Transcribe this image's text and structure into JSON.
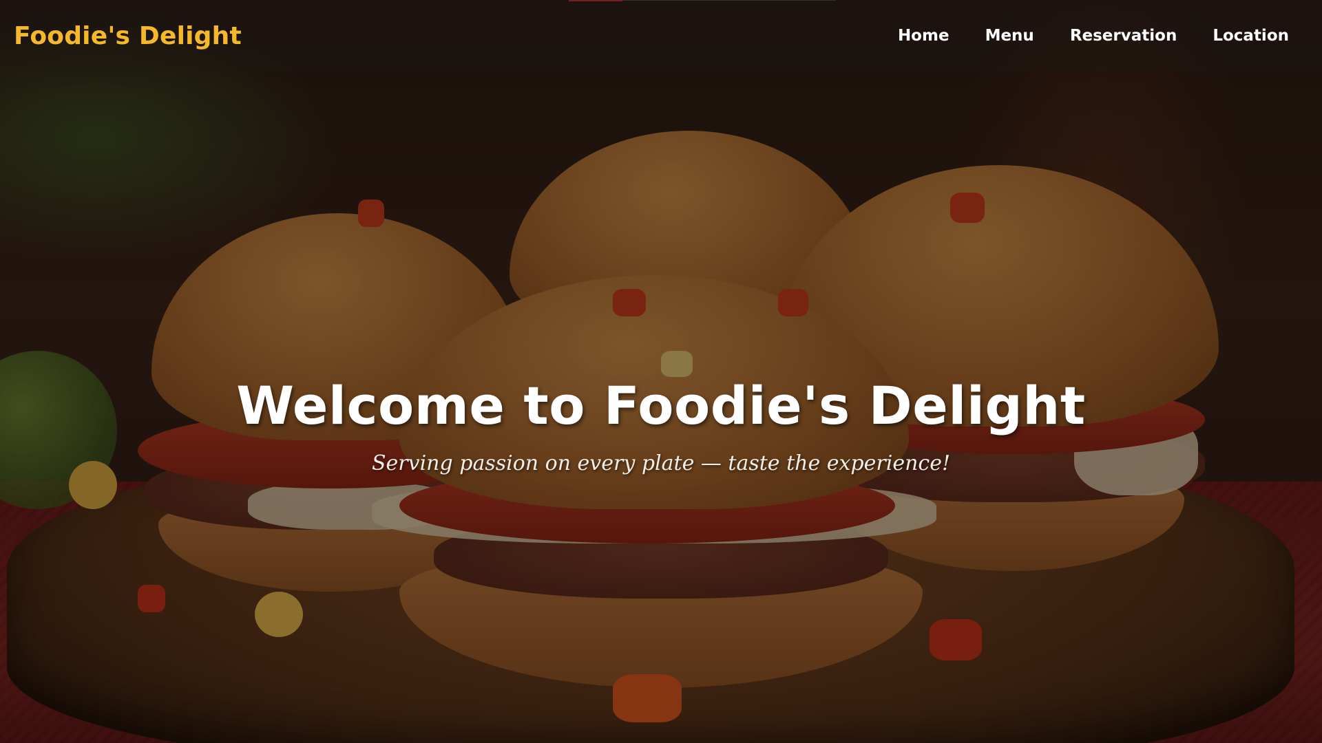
{
  "header": {
    "brand": "Foodie's Delight",
    "nav": [
      {
        "label": "Home"
      },
      {
        "label": "Menu"
      },
      {
        "label": "Reservation"
      },
      {
        "label": "Location"
      }
    ]
  },
  "hero": {
    "title": "Welcome to Foodie's Delight",
    "subtitle": "Serving passion on every plate — taste the experience!",
    "background_image": "sliders-burgers-photo"
  },
  "colors": {
    "brand": "#f5b82a",
    "nav_text": "#ffffff",
    "accent_top": "#c4232b"
  }
}
